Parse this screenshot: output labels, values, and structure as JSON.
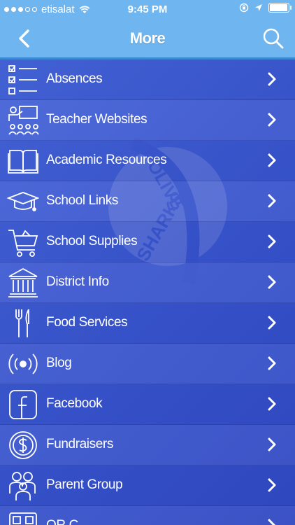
{
  "status_bar": {
    "carrier": "etisalat",
    "time": "9:45 PM",
    "battery_level": 0.9,
    "signal_bars": 3
  },
  "nav": {
    "title": "More",
    "back_icon": "chevron-left-icon",
    "search_icon": "search-icon"
  },
  "menu": [
    {
      "label": "Absences",
      "icon": "checklist-icon"
    },
    {
      "label": "Teacher Websites",
      "icon": "teacher-icon"
    },
    {
      "label": "Academic Resources",
      "icon": "book-icon"
    },
    {
      "label": "School Links",
      "icon": "graduation-cap-icon"
    },
    {
      "label": "School Supplies",
      "icon": "cart-icon"
    },
    {
      "label": "District Info",
      "icon": "building-icon"
    },
    {
      "label": "Food Services",
      "icon": "fork-knife-icon"
    },
    {
      "label": "Blog",
      "icon": "broadcast-icon"
    },
    {
      "label": "Facebook",
      "icon": "facebook-icon"
    },
    {
      "label": "Fundraisers",
      "icon": "dollar-icon"
    },
    {
      "label": "Parent Group",
      "icon": "group-icon"
    },
    {
      "label": "QR C...",
      "icon": "qr-code-icon"
    }
  ],
  "watermark": {
    "text1": "OLIVE",
    "text2": "SHARKS"
  },
  "colors": {
    "nav": "#6fb6f0",
    "list": "#3b57cf",
    "text": "#ffffff"
  }
}
